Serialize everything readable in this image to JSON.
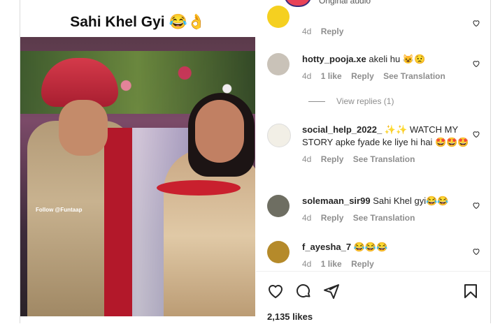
{
  "media": {
    "caption": "Sahi Khel Gyi 😂👌",
    "watermark": "Follow @Funtaap"
  },
  "topbar": {
    "text": "Original audio"
  },
  "comments": [
    {
      "user": "",
      "text": "",
      "time": "4d",
      "likes": "",
      "reply": "Reply",
      "translate": ""
    },
    {
      "user": "hotty_pooja.xe",
      "text": "akeli hu 😺😟",
      "time": "4d",
      "likes": "1 like",
      "reply": "Reply",
      "translate": "See Translation"
    },
    {
      "user": "social_help_2022_",
      "text": "✨✨ WATCH MY STORY apke fyade ke liye hi hai 🤩🤩🤩",
      "time": "4d",
      "likes": "",
      "reply": "Reply",
      "translate": "See Translation"
    },
    {
      "user": "solemaan_sir99",
      "text": "Sahi Khel gyi😂😂",
      "time": "4d",
      "likes": "",
      "reply": "Reply",
      "translate": "See Translation"
    },
    {
      "user": "f_ayesha_7",
      "text": "😂😂😂",
      "time": "4d",
      "likes": "1 like",
      "reply": "Reply",
      "translate": ""
    }
  ],
  "view_replies": "View replies (1)",
  "likes_count": "2,135 likes",
  "colors": {
    "muted": "#8e8e8e",
    "text": "#262626",
    "border": "#dbdbdb"
  }
}
